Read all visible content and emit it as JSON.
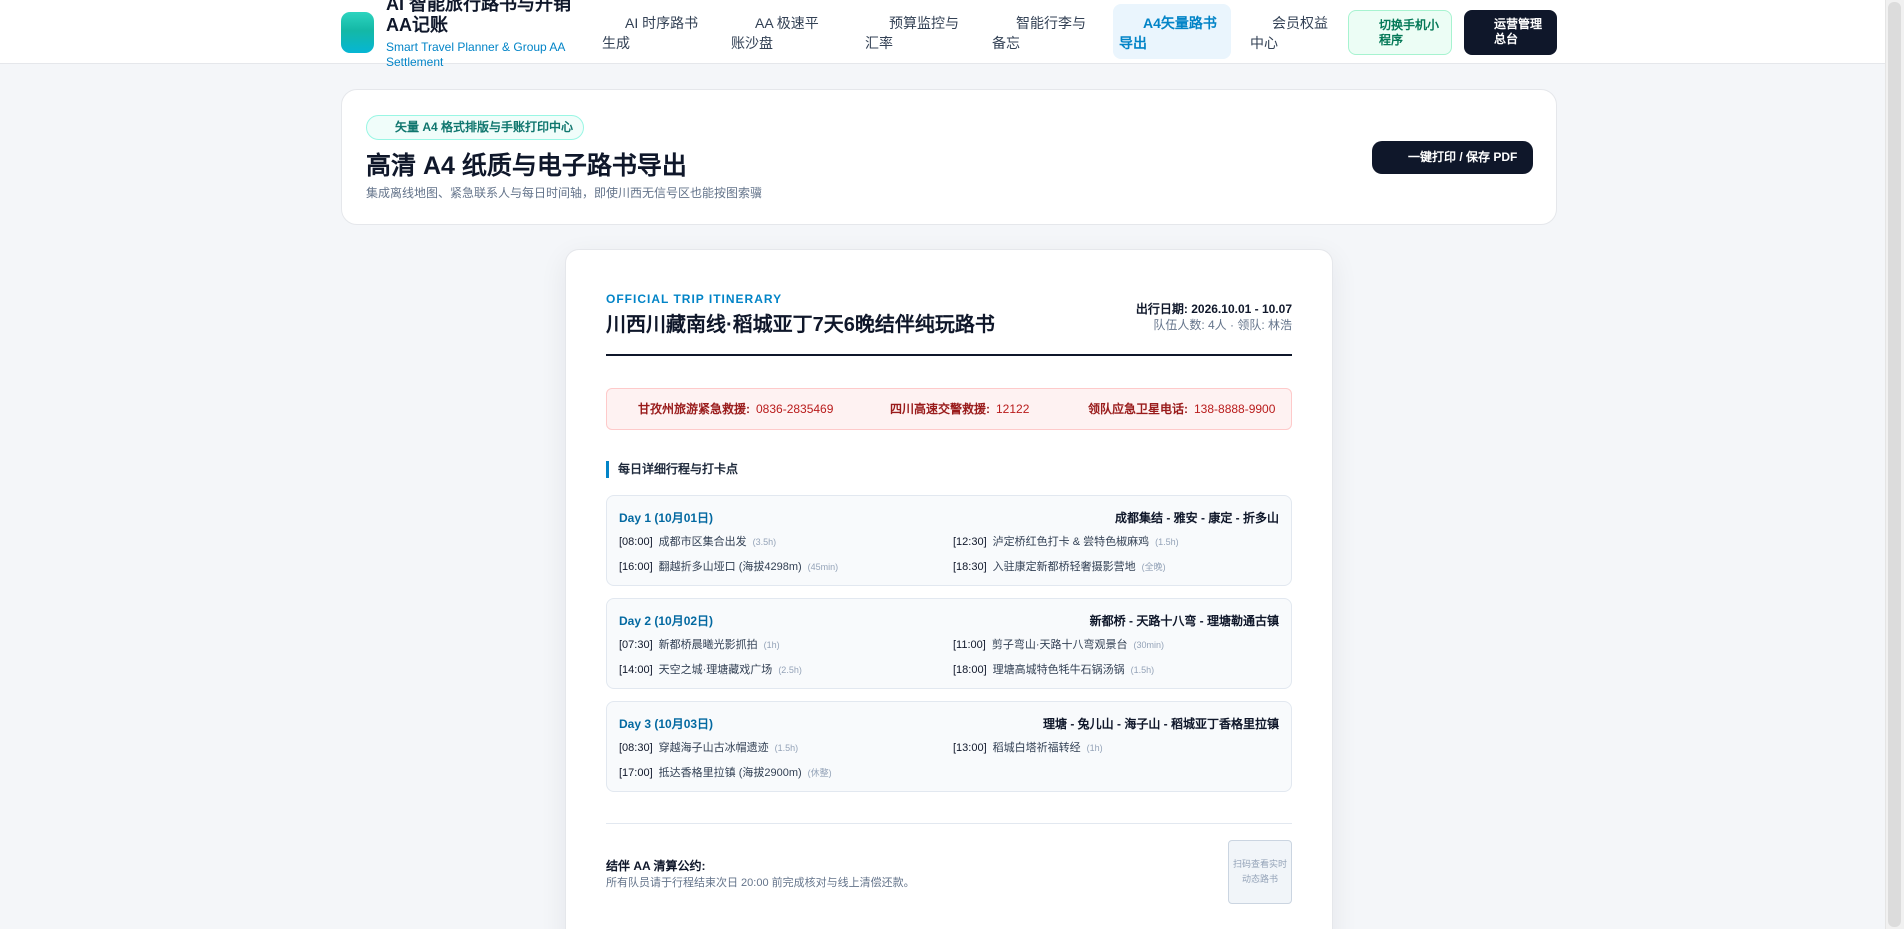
{
  "brand": {
    "title": "AI 智能旅行路书与开销AA记账",
    "subtitle": "Smart Travel Planner & Group AA Settlement"
  },
  "nav": {
    "items": [
      {
        "label": "AI 时序路书生成",
        "active": false
      },
      {
        "label": "AA 极速平账沙盘",
        "active": false
      },
      {
        "label": "预算监控与汇率",
        "active": false
      },
      {
        "label": "智能行李与备忘",
        "active": false
      },
      {
        "label": "A4矢量路书导出",
        "active": true
      },
      {
        "label": "会员权益中心",
        "active": false
      }
    ],
    "mini_program_button": "切换手机小程序",
    "admin_button": "运营管理总台"
  },
  "header_card": {
    "badge": "矢量 A4 格式排版与手账打印中心",
    "title": "高清 A4 纸质与电子路书导出",
    "description": "集成离线地图、紧急联系人与每日时间轴，即使川西无信号区也能按图索骥",
    "print_button": "一键打印 / 保存 PDF"
  },
  "sheet": {
    "eyebrow": "OFFICIAL TRIP ITINERARY",
    "title": "川西川藏南线·稻城亚丁7天6晚结伴纯玩路书",
    "date_line": "出行日期: 2026.10.01 - 10.07",
    "team_line": "队伍人数: 4人 · 领队: 林浩",
    "emergency": [
      {
        "label": "甘孜州旅游紧急救援:",
        "value": "0836-2835469"
      },
      {
        "label": "四川高速交警救援:",
        "value": "12122"
      },
      {
        "label": "领队应急卫星电话:",
        "value": "138-8888-9900"
      }
    ],
    "section_title": "每日详细行程与打卡点",
    "days": [
      {
        "label": "Day 1 (10月01日)",
        "route": "成都集结 - 雅安 - 康定 - 折多山",
        "events": [
          {
            "time": "[08:00]",
            "text": "成都市区集合出发",
            "dur": "(3.5h)"
          },
          {
            "time": "[12:30]",
            "text": "泸定桥红色打卡 & 尝特色椒麻鸡",
            "dur": "(1.5h)"
          },
          {
            "time": "[16:00]",
            "text": "翻越折多山垭口 (海拔4298m)",
            "dur": "(45min)"
          },
          {
            "time": "[18:30]",
            "text": "入驻康定新都桥轻奢摄影营地",
            "dur": "(全晚)"
          }
        ]
      },
      {
        "label": "Day 2 (10月02日)",
        "route": "新都桥 - 天路十八弯 - 理塘勒通古镇",
        "events": [
          {
            "time": "[07:30]",
            "text": "新都桥晨曦光影抓拍",
            "dur": "(1h)"
          },
          {
            "time": "[11:00]",
            "text": "剪子弯山·天路十八弯观景台",
            "dur": "(30min)"
          },
          {
            "time": "[14:00]",
            "text": "天空之城·理塘藏戏广场",
            "dur": "(2.5h)"
          },
          {
            "time": "[18:00]",
            "text": "理塘高城特色牦牛石锅汤锅",
            "dur": "(1.5h)"
          }
        ]
      },
      {
        "label": "Day 3 (10月03日)",
        "route": "理塘 - 兔儿山 - 海子山 - 稻城亚丁香格里拉镇",
        "events": [
          {
            "time": "[08:30]",
            "text": "穿越海子山古冰帽遗迹",
            "dur": "(1.5h)"
          },
          {
            "time": "[13:00]",
            "text": "稻城白塔祈福转经",
            "dur": "(1h)"
          },
          {
            "time": "[17:00]",
            "text": "抵达香格里拉镇 (海拔2900m)",
            "dur": "(休整)"
          }
        ]
      }
    ],
    "settlement_title": "结伴 AA 清算公约:",
    "settlement_text": "所有队员请于行程结束次日 20:00 前完成核对与线上清偿还款。",
    "qr_text": "扫码查看实时动态路书"
  }
}
